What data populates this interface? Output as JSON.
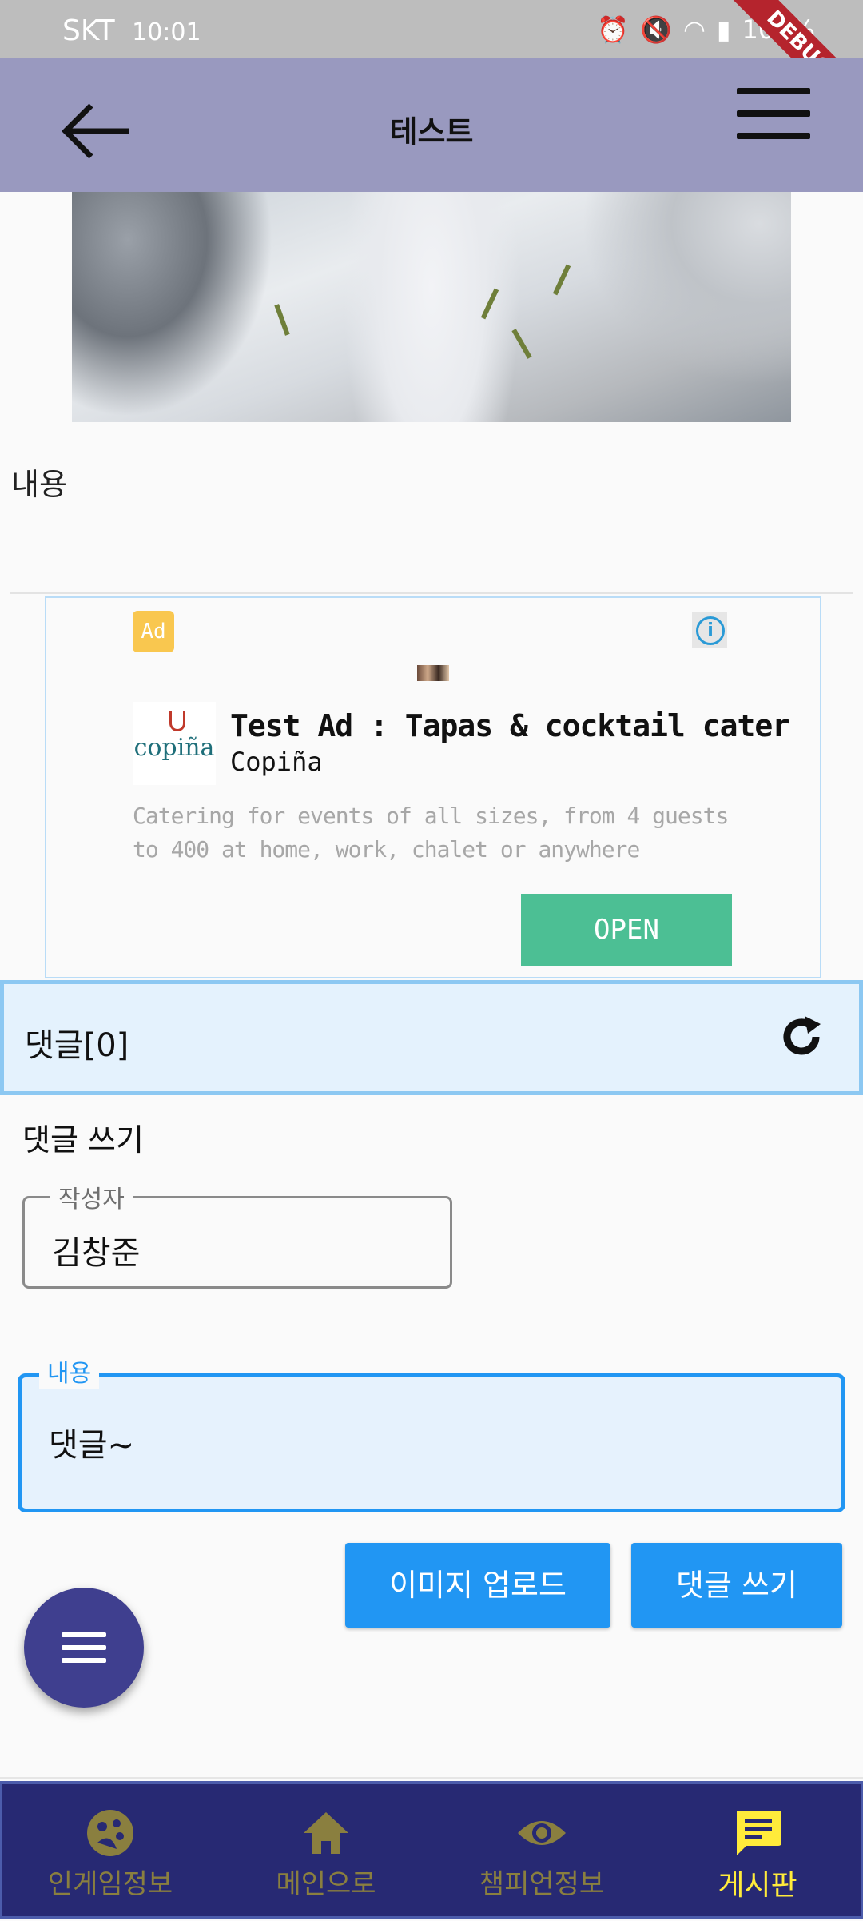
{
  "status_bar": {
    "carrier": "SKT",
    "time": "10:01",
    "battery": "100%",
    "debug_banner": "DEBUG"
  },
  "app_bar": {
    "title": "테스트",
    "back_icon": "arrow-left-icon",
    "menu_icon": "hamburger-menu-icon"
  },
  "post": {
    "photo_alt": "snowman photo",
    "content_label": "내용"
  },
  "ad": {
    "badge": "Ad",
    "title": "Test Ad : Tapas & cocktail cater...",
    "brand": "Copiña",
    "logo_text": "copiña",
    "description": "Catering for events of all sizes, from 4 guests to 400 at home, work, chalet or anywhere",
    "cta": "OPEN",
    "colors": {
      "badge": "#f9c74f",
      "cta": "#4cbf94"
    }
  },
  "comments": {
    "header": "댓글[0]",
    "refresh_icon": "refresh-icon",
    "write_title": "댓글 쓰기",
    "author_label": "작성자",
    "author_value": "김창준",
    "content_label": "내용",
    "content_value": "댓글~",
    "upload_button": "이미지 업로드",
    "submit_button": "댓글 쓰기"
  },
  "fab": {
    "icon": "menu-icon"
  },
  "bottom_nav": {
    "items": [
      {
        "label": "인게임정보",
        "icon": "game-icon",
        "active": false
      },
      {
        "label": "메인으로",
        "icon": "home-icon",
        "active": false
      },
      {
        "label": "챔피언정보",
        "icon": "eye-icon",
        "active": false
      },
      {
        "label": "게시판",
        "icon": "message-board-icon",
        "active": true
      }
    ],
    "colors": {
      "background": "#272973",
      "active": "#ffeb3b",
      "inactive": "#8a7f3f"
    }
  }
}
